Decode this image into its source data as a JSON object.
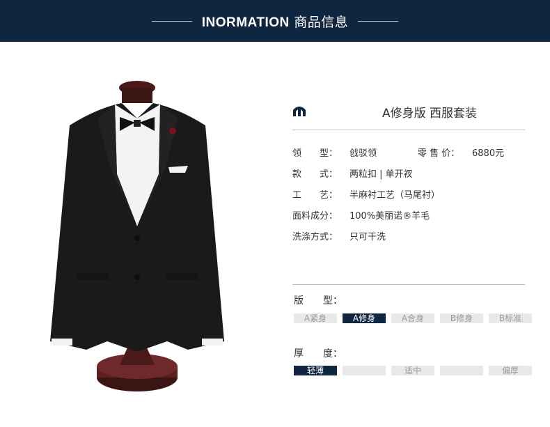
{
  "banner": {
    "title_en": "INORMATION",
    "title_cn": "商品信息"
  },
  "product": {
    "name": "A修身版 西服套装",
    "specs": [
      {
        "label": "领　　型：",
        "value": "戗驳领",
        "label2": "零  售  价：",
        "value2": "6880元"
      },
      {
        "label": "款　　式：",
        "value": "两粒扣 | 单开衩"
      },
      {
        "label": "工　　艺：",
        "value": "半麻衬工艺（马尾衬）"
      },
      {
        "label": "面料成分：",
        "value": "100%美丽诺®羊毛"
      },
      {
        "label": "洗涤方式：",
        "value": "只可干洗"
      }
    ]
  },
  "fit": {
    "label": "版　　型：",
    "options": [
      "A紧身",
      "A修身",
      "A合身",
      "B修身",
      "B标准"
    ],
    "selected": "A修身"
  },
  "thickness": {
    "label": "厚　　度：",
    "options": [
      "轻薄",
      "",
      "适中",
      "",
      "偏厚"
    ],
    "selected": "轻薄"
  },
  "colors": {
    "banner": "#0f2640",
    "active": "#0f2640",
    "inactive": "#e9e9e9"
  }
}
